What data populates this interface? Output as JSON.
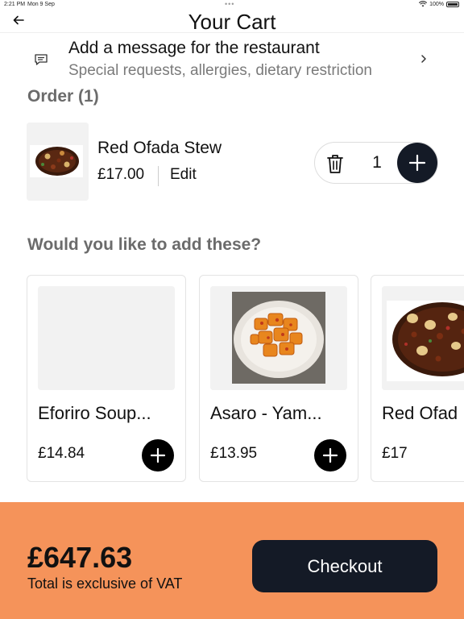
{
  "status_bar": {
    "time": "2:21 PM",
    "date": "Mon 9 Sep",
    "battery": "100%",
    "icons": [
      "wifi-icon",
      "battery-icon"
    ]
  },
  "header": {
    "title": "Your Cart",
    "back_icon": "back-arrow-icon"
  },
  "message": {
    "title": "Add a message for the restaurant",
    "subtitle": "Special requests, allergies, dietary restriction",
    "icon": "message-icon",
    "chevron": "chevron-right-icon"
  },
  "order": {
    "section_title": "Order (1)",
    "items": [
      {
        "name": "Red Ofada Stew",
        "price": "£17.00",
        "edit_label": "Edit",
        "quantity": "1"
      }
    ]
  },
  "suggestions": {
    "section_title": "Would you like to add these?",
    "items": [
      {
        "name": "Eforiro Soup...",
        "price": "£14.84"
      },
      {
        "name": "Asaro - Yam...",
        "price": "£13.95"
      },
      {
        "name": "Red Ofad",
        "price": "£17"
      }
    ]
  },
  "footer": {
    "total": "£647.63",
    "vat_note": "Total is exclusive of VAT",
    "checkout_label": "Checkout"
  },
  "colors": {
    "accent": "#F5935A",
    "dark": "#141A26",
    "muted_text": "#6B6B6B"
  }
}
